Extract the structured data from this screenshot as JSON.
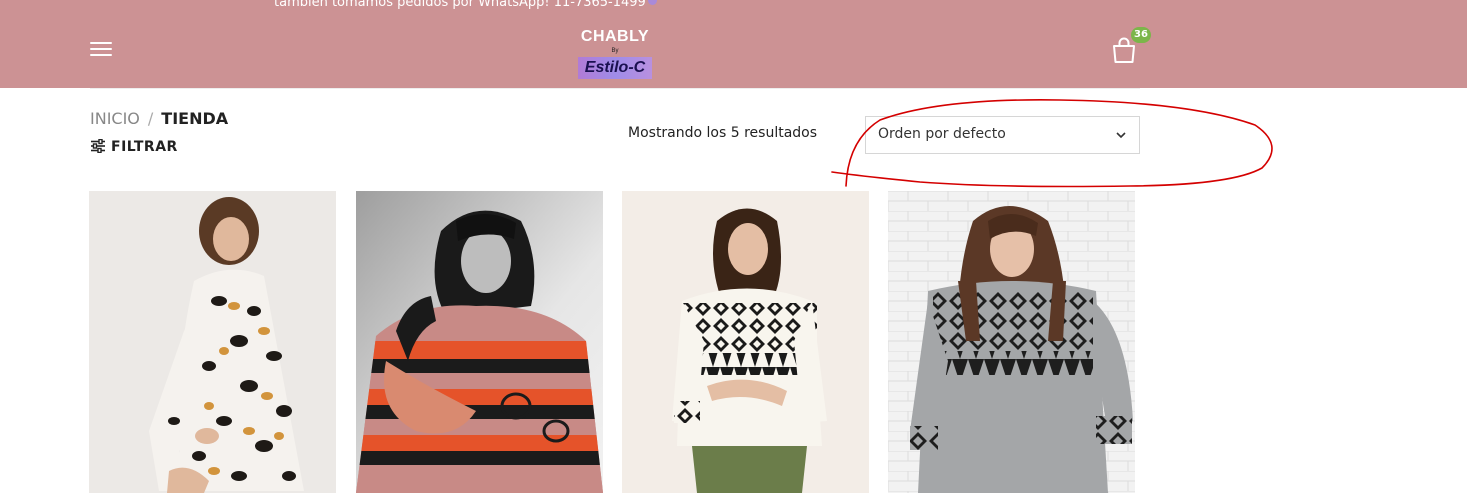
{
  "topbar": {
    "message": "también tomamos pedidos por WhatsApp! 11-7365-1499"
  },
  "logo": {
    "line1": "CHABLY",
    "line2": "By",
    "line3": "Estilo-C"
  },
  "cart": {
    "count": "36",
    "badge_color": "#7bb64a"
  },
  "icons": {
    "menu": "hamburger-icon",
    "cart": "shopping-bag-icon",
    "filter": "sliders-icon",
    "sort": "chevron-down-icon"
  },
  "colors": {
    "header_bg": "#cc9294",
    "annotation": "#d40000"
  },
  "breadcrumb": {
    "home": "INICIO",
    "separator": "/",
    "current": "TIENDA"
  },
  "filter": {
    "label": "FILTRAR"
  },
  "results": {
    "text": "Mostrando los 5 resultados"
  },
  "sort": {
    "selected": "Orden por defecto"
  },
  "products": [
    {
      "style": "leopard-print shirt dress"
    },
    {
      "style": "red & gray striped sweater"
    },
    {
      "style": "white sweater with black pattern"
    },
    {
      "style": "gray sweater with black pattern"
    }
  ]
}
